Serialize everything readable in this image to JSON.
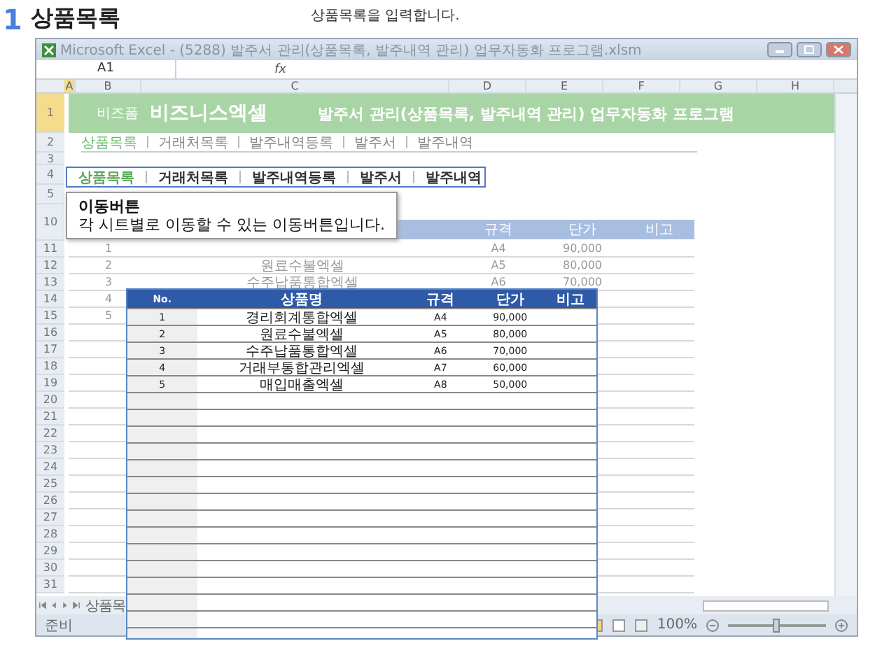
{
  "page_header": {
    "number": "1",
    "title": "상품목록",
    "caption": "상품목록을 입력합니다."
  },
  "excel": {
    "title": "Microsoft Excel - (5288) 발주서 관리(상품목록, 발주내역 관리) 업무자동화 프로그램.xlsm",
    "name_box": "A1",
    "fx": "fx",
    "columns": [
      {
        "label": "A",
        "selected": true
      },
      {
        "label": "B",
        "selected": false
      },
      {
        "label": "C",
        "selected": false
      },
      {
        "label": "D",
        "selected": false
      },
      {
        "label": "E",
        "selected": false
      },
      {
        "label": "F",
        "selected": false
      },
      {
        "label": "G",
        "selected": false
      },
      {
        "label": "H",
        "selected": false
      }
    ],
    "banner": {
      "brand_small": "비즈폼",
      "brand": "비즈니스엑셀",
      "title": "발주서 관리(상품목록, 발주내역 관리) 업무자동화 프로그램"
    },
    "top_nav": [
      {
        "label": "상품목록",
        "selected": true
      },
      {
        "label": "거래처목록",
        "selected": false
      },
      {
        "label": "발주내역등록",
        "selected": false
      },
      {
        "label": "발주서",
        "selected": false
      },
      {
        "label": "발주내역",
        "selected": false
      }
    ],
    "rows": [
      {
        "num": "1",
        "kind": "banner",
        "selected": true
      },
      {
        "num": "2",
        "kind": "links",
        "selected": false
      },
      {
        "num": "3",
        "kind": "short",
        "selected": false
      },
      {
        "num": "4",
        "kind": "blank",
        "selected": false
      },
      {
        "num": "5",
        "kind": "blank",
        "selected": false
      },
      {
        "num": "10",
        "kind": "header",
        "selected": false
      },
      {
        "num": "11",
        "kind": "item",
        "selected": false,
        "no": "1",
        "spec": "A4",
        "price": "90,000"
      },
      {
        "num": "12",
        "kind": "item",
        "selected": false,
        "no": "2",
        "name": "원료수불엑셀",
        "spec": "A5",
        "price": "80,000"
      },
      {
        "num": "13",
        "kind": "item",
        "selected": false,
        "no": "3",
        "name": "수주납품통합엑셀",
        "spec": "A6",
        "price": "70,000"
      },
      {
        "num": "14",
        "kind": "item",
        "selected": false,
        "no": "4"
      },
      {
        "num": "15",
        "kind": "item",
        "selected": false,
        "no": "5"
      },
      {
        "num": "16",
        "kind": "grid",
        "selected": false
      },
      {
        "num": "17",
        "kind": "grid",
        "selected": false
      },
      {
        "num": "18",
        "kind": "grid",
        "selected": false
      },
      {
        "num": "19",
        "kind": "grid",
        "selected": false
      },
      {
        "num": "20",
        "kind": "grid",
        "selected": false
      },
      {
        "num": "21",
        "kind": "grid",
        "selected": false
      },
      {
        "num": "22",
        "kind": "grid",
        "selected": false
      },
      {
        "num": "23",
        "kind": "grid",
        "selected": false
      },
      {
        "num": "24",
        "kind": "grid",
        "selected": false
      },
      {
        "num": "25",
        "kind": "grid",
        "selected": false
      },
      {
        "num": "26",
        "kind": "grid",
        "selected": false
      },
      {
        "num": "27",
        "kind": "grid",
        "selected": false
      },
      {
        "num": "28",
        "kind": "grid",
        "selected": false
      },
      {
        "num": "29",
        "kind": "grid",
        "selected": false
      },
      {
        "num": "30",
        "kind": "grid",
        "selected": false
      },
      {
        "num": "31",
        "kind": "grid",
        "selected": false
      }
    ],
    "sheet_table_columns": [
      "규격",
      "단가",
      "비고"
    ],
    "nav_buttons": [
      {
        "label": "상품목록",
        "selected": true
      },
      {
        "label": "거래처목록",
        "selected": false
      },
      {
        "label": "발주내역등록",
        "selected": false
      },
      {
        "label": "발주서",
        "selected": false
      },
      {
        "label": "발주내역",
        "selected": false
      }
    ],
    "callout": {
      "title": "이동버튼",
      "text": "각 시트별로 이동할 수 있는 이동버튼입니다."
    },
    "sheet_tab": "상품목",
    "status": "준비",
    "zoom": "100%",
    "zoom_slider": {
      "level": 0.5
    }
  },
  "floating_table": {
    "columns": [
      "No.",
      "상품명",
      "규격",
      "단가",
      "비고"
    ],
    "rows": [
      {
        "no": "1",
        "name": "경리회계통합엑셀",
        "spec": "A4",
        "price": "90,000"
      },
      {
        "no": "2",
        "name": "원료수불엑셀",
        "spec": "A5",
        "price": "80,000"
      },
      {
        "no": "3",
        "name": "수주납품통합엑셀",
        "spec": "A6",
        "price": "70,000"
      },
      {
        "no": "4",
        "name": "거래부통합관리엑셀",
        "spec": "A7",
        "price": "60,000"
      },
      {
        "no": "5",
        "name": "매입매출엑셀",
        "spec": "A8",
        "price": "50,000"
      }
    ]
  }
}
